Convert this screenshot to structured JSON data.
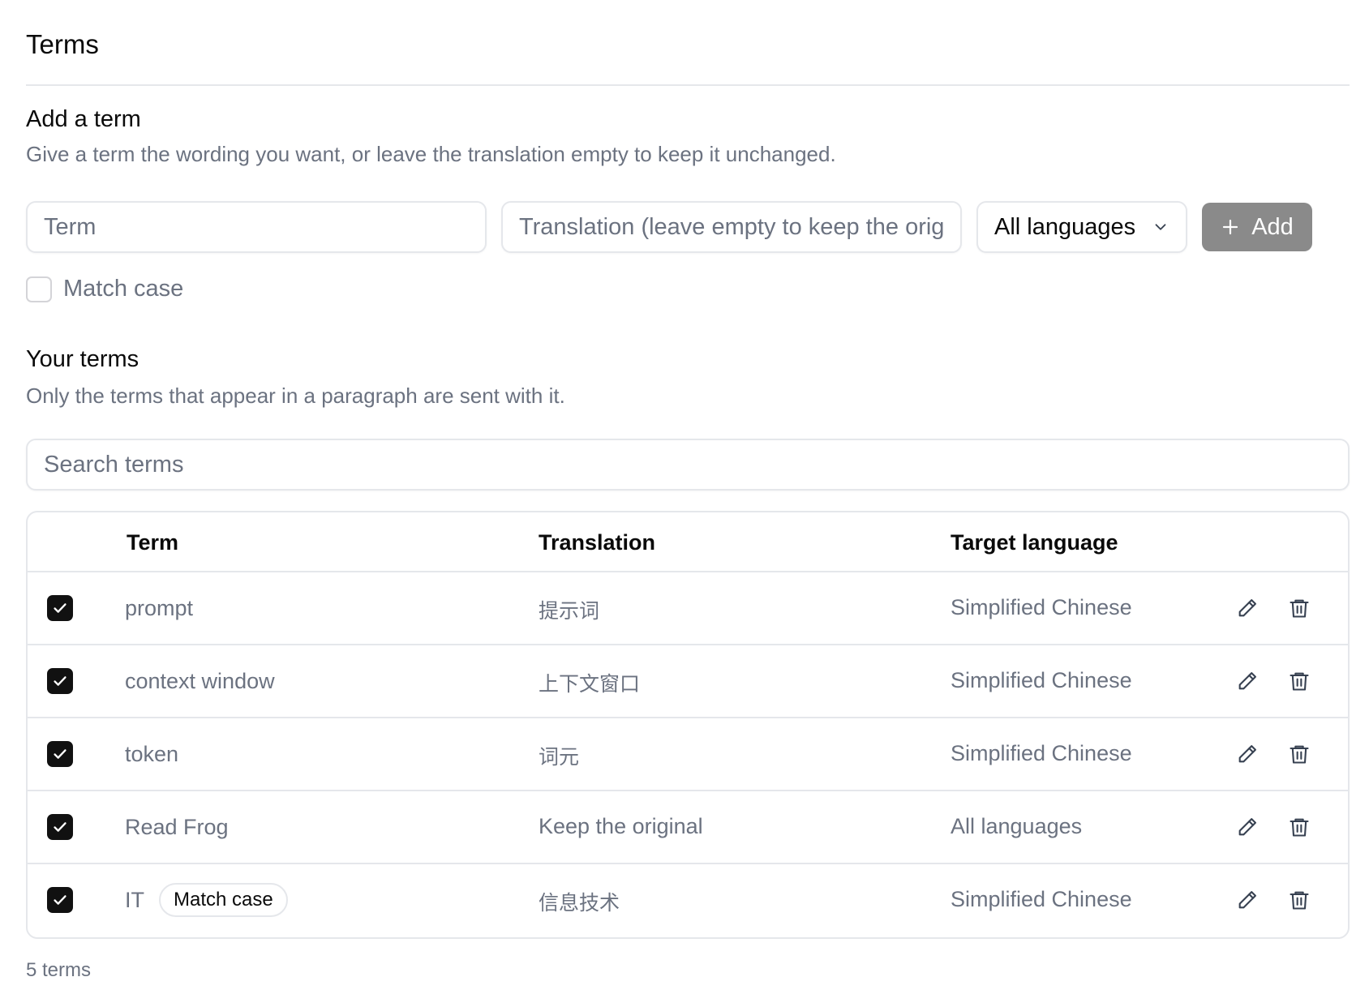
{
  "page": {
    "title": "Terms"
  },
  "add_section": {
    "title": "Add a term",
    "description": "Give a term the wording you want, or leave the translation empty to keep it unchanged.",
    "term_placeholder": "Term",
    "translation_placeholder": "Translation (leave empty to keep the original)",
    "language_select": "All languages",
    "add_label": "Add",
    "match_case_label": "Match case"
  },
  "terms_section": {
    "title": "Your terms",
    "description": "Only the terms that appear in a paragraph are sent with it.",
    "search_placeholder": "Search terms"
  },
  "table": {
    "headers": {
      "term": "Term",
      "translation": "Translation",
      "language": "Target language"
    },
    "rows": [
      {
        "term": "prompt",
        "translation": "提示词",
        "language": "Simplified Chinese",
        "checked": true,
        "match_case": false
      },
      {
        "term": "context window",
        "translation": "上下文窗口",
        "language": "Simplified Chinese",
        "checked": true,
        "match_case": false
      },
      {
        "term": "token",
        "translation": "词元",
        "language": "Simplified Chinese",
        "checked": true,
        "match_case": false
      },
      {
        "term": "Read Frog",
        "translation": "Keep the original",
        "language": "All languages",
        "checked": true,
        "match_case": false
      },
      {
        "term": "IT",
        "translation": "信息技术",
        "language": "Simplified Chinese",
        "checked": true,
        "match_case": true,
        "badge": "Match case"
      }
    ]
  },
  "footer": {
    "count_label": "5 terms"
  },
  "icons": {
    "dropdown": "chevron-down-icon",
    "add": "plus-icon",
    "edit": "pencil-icon",
    "delete": "trash-icon",
    "check": "check-icon"
  },
  "colors": {
    "accent_button": "#8a8a8a",
    "checkbox_checked": "#111111",
    "border": "#e5e7eb",
    "muted_text": "#6b7280"
  }
}
